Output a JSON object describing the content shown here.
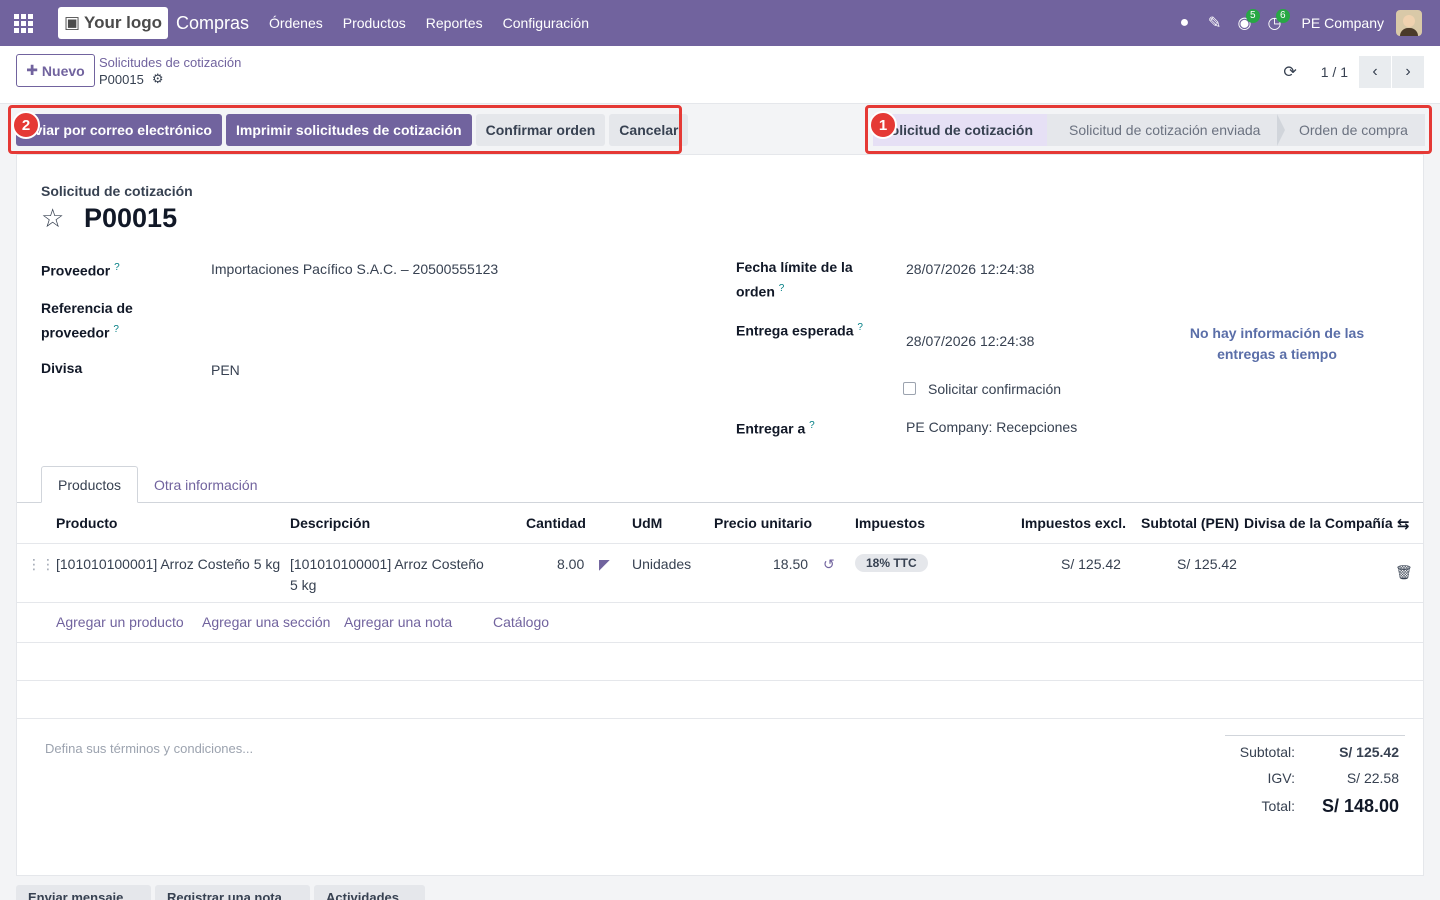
{
  "topbar": {
    "logo_text": "Your logo",
    "app_name": "Compras",
    "menu": [
      "Órdenes",
      "Productos",
      "Reportes",
      "Configuración"
    ],
    "chat_badge": "5",
    "activity_badge": "6",
    "company": "PE Company"
  },
  "control": {
    "new_label": "Nuevo",
    "breadcrumb_parent": "Solicitudes de cotización",
    "breadcrumb_current": "P00015",
    "pager": "1 / 1"
  },
  "actions": [
    "Enviar por correo electrónico",
    "Imprimir solicitudes de cotización",
    "Confirmar orden",
    "Cancelar"
  ],
  "stages": [
    "Solicitud de cotización",
    "Solicitud de cotización enviada",
    "Orden de compra"
  ],
  "annotations": {
    "one": "1",
    "two": "2"
  },
  "form": {
    "doc_type": "Solicitud de cotización",
    "name": "P00015",
    "vendor_label": "Proveedor",
    "vendor_value": "Importaciones Pacífico S.A.C. – 20500555123",
    "vendor_ref_label_1": "Referencia de",
    "vendor_ref_label_2": "proveedor",
    "currency_label": "Divisa",
    "currency_value": "PEN",
    "deadline_label_1": "Fecha límite de la",
    "deadline_label_2": "orden",
    "deadline_value": "28/07/2026 12:24:38",
    "expected_label": "Entrega esperada",
    "expected_value": "28/07/2026 12:24:38",
    "confirm_label": "Solicitar confirmación",
    "deliver_label": "Entregar a",
    "deliver_value": "PE Company: Recepciones",
    "ontime_1": "No hay información de las",
    "ontime_2": "entregas a tiempo",
    "help_mark": "?"
  },
  "tabs": [
    "Productos",
    "Otra información"
  ],
  "table": {
    "headers": [
      "Producto",
      "Descripción",
      "Cantidad",
      "UdM",
      "Precio unitario",
      "Impuestos",
      "Impuestos excl.",
      "Subtotal (PEN)",
      "Divisa de la Compañía"
    ],
    "rows": [
      {
        "product": "[101010100001] Arroz Costeño 5 kg",
        "desc_1": "[101010100001] Arroz Costeño",
        "desc_2": "5 kg",
        "qty": "8.00",
        "uom": "Unidades",
        "price": "18.50",
        "tax": "18% TTC",
        "excl": "S/ 125.42",
        "subtotal": "S/ 125.42"
      }
    ],
    "add_links": [
      "Agregar un producto",
      "Agregar una sección",
      "Agregar una nota",
      "Catálogo"
    ]
  },
  "terms_placeholder": "Defina sus términos y condiciones...",
  "totals": {
    "subtotal_label": "Subtotal:",
    "subtotal": "S/ 125.42",
    "igv_label": "IGV:",
    "igv": "S/ 22.58",
    "total_label": "Total:",
    "total": "S/ 148.00"
  },
  "bottom_buttons": [
    "Enviar mensaje",
    "Registrar una nota",
    "Actividades"
  ]
}
